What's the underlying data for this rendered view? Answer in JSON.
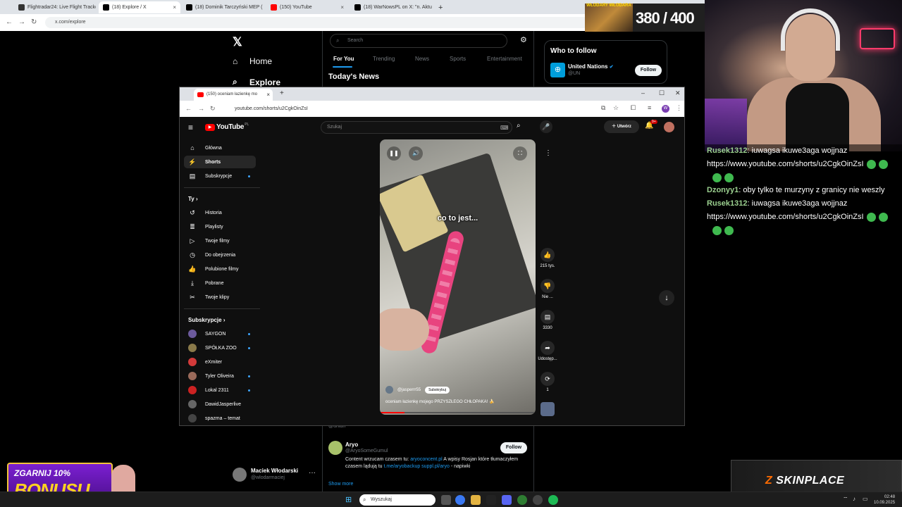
{
  "outer_browser": {
    "tabs": [
      {
        "label": "Flightradar24: Live Flight Tracke",
        "color": "#333333"
      },
      {
        "label": "(18) Explore / X",
        "color": "#000000"
      },
      {
        "label": "(18) Dominik Tarczyński MEP (",
        "color": "#000000"
      },
      {
        "label": "(150) YouTube",
        "color": "#ff0000"
      },
      {
        "label": "(18) WarNowsPL on X: \"n. Aktu",
        "color": "#000000"
      }
    ],
    "new_tab": "+",
    "url": "x.com/explore"
  },
  "x_page": {
    "logo": "𝕏",
    "nav": [
      {
        "icon": "⌂",
        "label": "Home"
      },
      {
        "icon": "⌕",
        "label": "Explore"
      }
    ],
    "search_placeholder": "Search",
    "tabs": [
      "For You",
      "Trending",
      "News",
      "Sports",
      "Entertainment"
    ],
    "section_title": "Today's News",
    "who_to_follow": {
      "title": "Who to follow",
      "account_name": "United Nations",
      "account_handle": "@UN",
      "follow_label": "Follow"
    },
    "feed": {
      "hidden_handle": "@urlian",
      "author": "Aryo",
      "handle": "@AryoSomeGumul",
      "follow_label": "Follow",
      "text_1": "Content wrzucam czasem tu: ",
      "link_1": "aryoconcent.pl",
      "text_2": " A wpisy Rosjan które tłumaczyłem czasem lądują tu ",
      "link_2": "t.me/aryobackup suppl.pl/aryo",
      "text_3": " - napiwki",
      "show_more": "Show more"
    },
    "account": {
      "name": "Maciek Włodarski",
      "handle": "@wlodarmaciej",
      "more": "···"
    }
  },
  "yt_window": {
    "tab_label": "(150) oceniam łazienkę mo",
    "url": "youtube.com/shorts/u2CgkOinZsI",
    "search_placeholder": "Szukaj",
    "create_label": "Utwórz",
    "notifications": "9+",
    "logo_text": "YouTube",
    "logo_region": "PL",
    "sidebar_main": [
      {
        "icon": "⌂",
        "label": "Główna"
      },
      {
        "icon": "⚡",
        "label": "Shorts"
      },
      {
        "icon": "▤",
        "label": "Subskrypcje"
      }
    ],
    "you_header": "Ty",
    "sidebar_you": [
      {
        "icon": "↺",
        "label": "Historia"
      },
      {
        "icon": "≣",
        "label": "Playlisty"
      },
      {
        "icon": "▷",
        "label": "Twoje filmy"
      },
      {
        "icon": "◷",
        "label": "Do obejrzenia"
      },
      {
        "icon": "👍",
        "label": "Polubione filmy"
      },
      {
        "icon": "⤓",
        "label": "Pobrane"
      },
      {
        "icon": "✂",
        "label": "Twoje klipy"
      }
    ],
    "subs_header": "Subskrypcje",
    "subscriptions": [
      {
        "label": "SAYGON",
        "color": "#6c5a9c"
      },
      {
        "label": "SPÓŁKA ZOO",
        "color": "#8a7a4a"
      },
      {
        "label": "eXmiter",
        "color": "#d33a3a"
      },
      {
        "label": "Tyler Oliveira",
        "color": "#9a6a5a"
      },
      {
        "label": "Lokal 2311",
        "color": "#cc2222"
      },
      {
        "label": "DawidJasperlive",
        "color": "#666666"
      },
      {
        "label": "spazma – temat",
        "color": "#444444"
      }
    ],
    "short": {
      "caption": "co to jest...",
      "channel": "@jasperrr55",
      "subscribe_label": "Subskrybuj",
      "description": "oceniam łazienkę mojego PRZYSZŁEGO CHŁOPAKA! 🍌",
      "progress": 0.16,
      "actions": [
        {
          "icon": "👍",
          "label": "215 tys."
        },
        {
          "icon": "👎",
          "label": "Nie ..."
        },
        {
          "icon": "▤",
          "label": "3330"
        },
        {
          "icon": "➦",
          "label": "Udostęp..."
        },
        {
          "icon": "⟳",
          "label": "1"
        }
      ]
    }
  },
  "overlay": {
    "counter_banner": "WŁODARY WŁODARA",
    "counter": "380 / 400",
    "chat": [
      {
        "user": "Rusek1312",
        "text": "iuwagsa ikuwe3aga wojjnaz https://www.youtube.com/shorts/u2CgkOinZsI",
        "emotes": 4
      },
      {
        "user": "Dzonyy1",
        "text": "oby tylko te murzyny z granicy nie weszly",
        "emotes": 0
      },
      {
        "user": "Rusek1312",
        "text": "iuwagsa ikuwe3aga wojjnaz https://www.youtube.com/shorts/u2CgkOinZsI",
        "emotes": 4
      }
    ],
    "bonus_line1": "ZGARNIJ 10%",
    "bonus_line2": "BONUSU",
    "skinplace": "SKINPLACE",
    "skinplace_mark": "Z"
  },
  "taskbar": {
    "search_placeholder": "Wyszukaj",
    "time": "02:48",
    "date": "10.09.2025"
  }
}
